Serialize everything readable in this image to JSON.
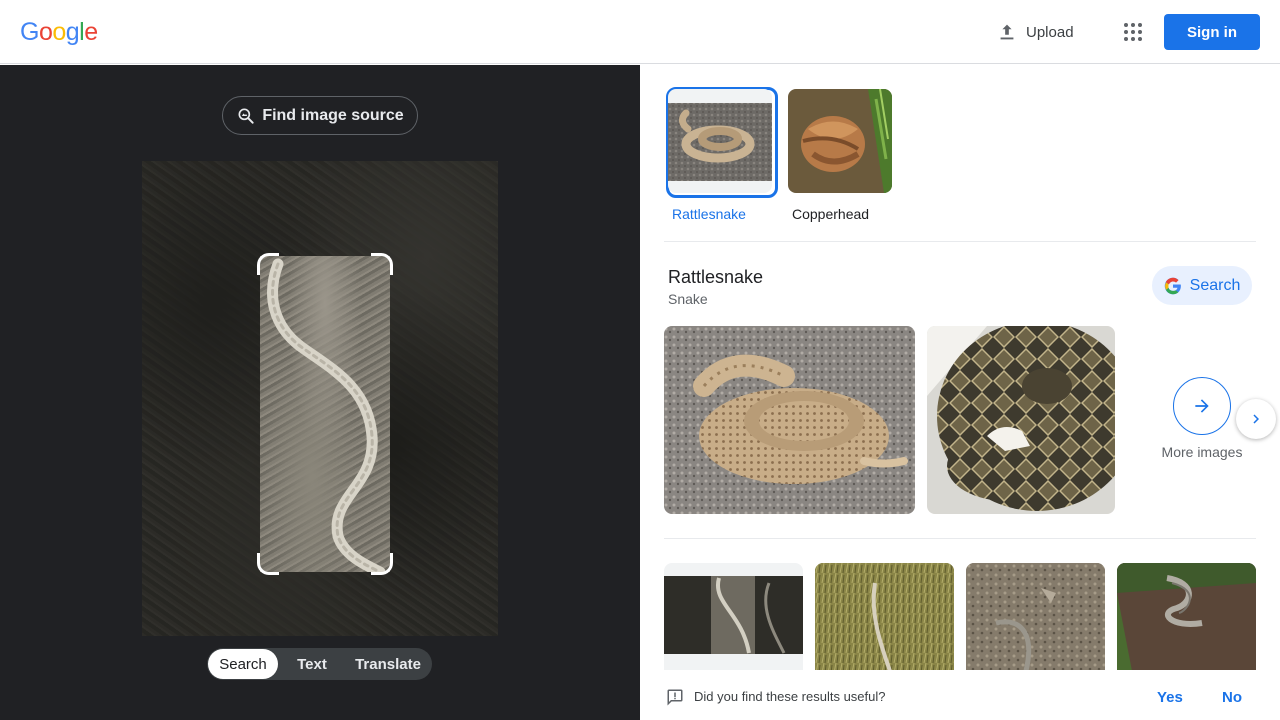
{
  "header": {
    "logo_letters": [
      {
        "char": "G",
        "color": "#4285f4"
      },
      {
        "char": "o",
        "color": "#ea4335"
      },
      {
        "char": "o",
        "color": "#fbbc05"
      },
      {
        "char": "g",
        "color": "#4285f4"
      },
      {
        "char": "l",
        "color": "#34a853"
      },
      {
        "char": "e",
        "color": "#ea4335"
      }
    ],
    "upload_label": "Upload",
    "signin_label": "Sign in"
  },
  "lens": {
    "find_source_label": "Find image source",
    "modes": [
      "Search",
      "Text",
      "Translate"
    ],
    "active_mode": "Search"
  },
  "results": {
    "chips": [
      {
        "label": "Rattlesnake",
        "selected": true
      },
      {
        "label": "Copperhead",
        "selected": false
      }
    ],
    "entity": {
      "title": "Rattlesnake",
      "subtitle": "Snake",
      "search_label": "Search"
    },
    "more_images_label": "More images",
    "feedback": {
      "question": "Did you find these results useful?",
      "yes": "Yes",
      "no": "No"
    }
  },
  "colors": {
    "accent": "#1a73e8",
    "left_panel_bg": "#202124"
  }
}
